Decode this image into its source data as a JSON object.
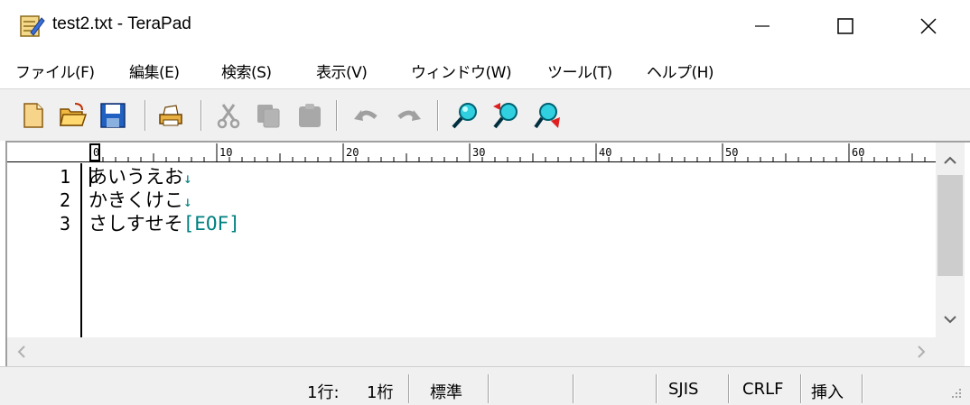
{
  "window": {
    "title": "test2.txt - TeraPad"
  },
  "menu": [
    {
      "label": "ファイル(F)"
    },
    {
      "label": "編集(E)"
    },
    {
      "label": "検索(S)"
    },
    {
      "label": "表示(V)"
    },
    {
      "label": "ウィンドウ(W)"
    },
    {
      "label": "ツール(T)"
    },
    {
      "label": "ヘルプ(H)"
    }
  ],
  "toolbar": {
    "icons": [
      "new-file-icon",
      "open-folder-icon",
      "save-icon",
      "print-icon",
      "cut-icon",
      "copy-icon",
      "paste-icon",
      "undo-icon",
      "redo-icon",
      "search-icon",
      "search-next-icon",
      "replace-icon"
    ]
  },
  "ruler": {
    "marks": [
      "0",
      "10",
      "20",
      "30",
      "40",
      "50",
      "60"
    ]
  },
  "editor": {
    "lines": [
      {
        "num": "1",
        "text": "あいうえお",
        "end": "↓"
      },
      {
        "num": "2",
        "text": "かきくけこ",
        "end": "↓"
      },
      {
        "num": "3",
        "text": "さしすせそ",
        "end": "[EOF]"
      }
    ]
  },
  "status": {
    "row": "1行:",
    "col": "1桁",
    "mode": "標準",
    "encoding": "SJIS",
    "newline": "CRLF",
    "insert": "挿入"
  },
  "colors": {
    "eol_marker": "#008080",
    "toolbar_bg": "#f0f0f0",
    "search_icon": "#00b0c0"
  }
}
